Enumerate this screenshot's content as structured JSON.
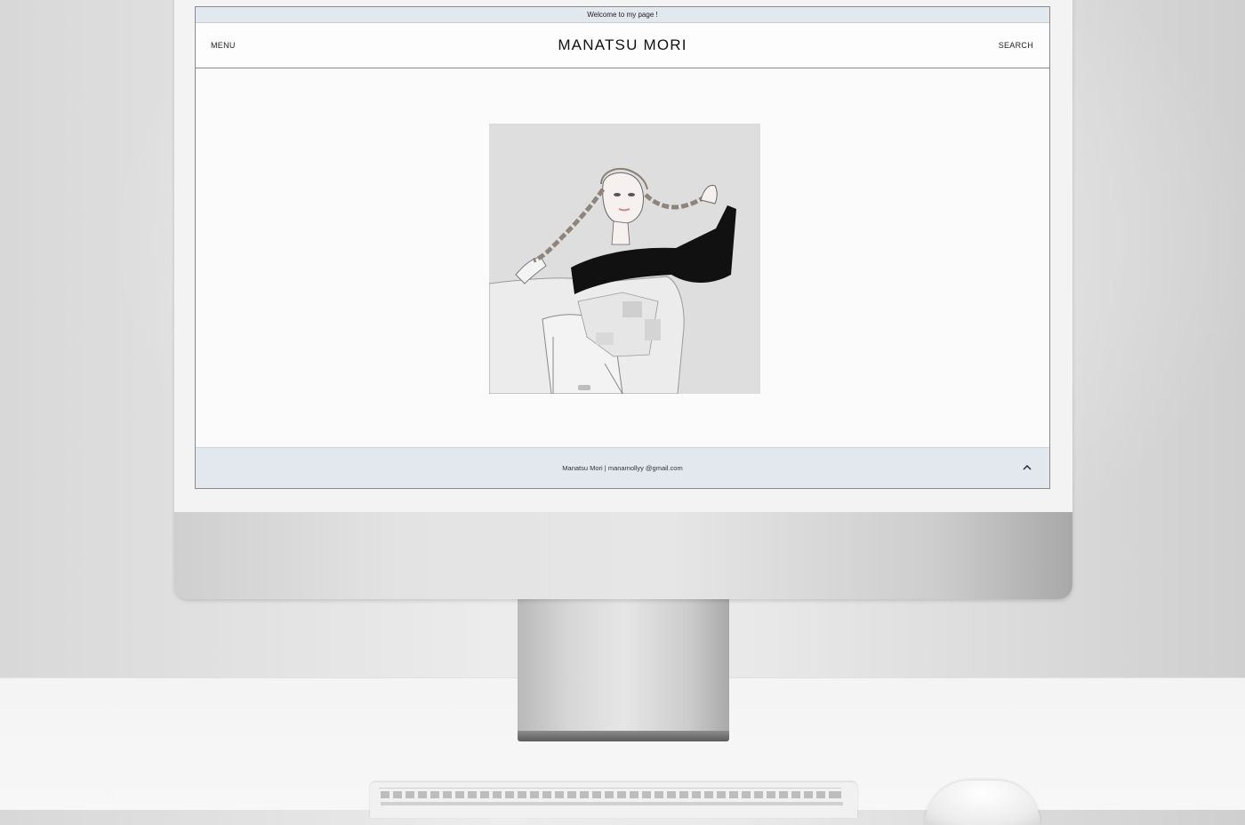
{
  "announcement": "Welcome to my page !",
  "header": {
    "menu_label": "MENU",
    "site_title": "MANATSU MORI",
    "search_label": "SEARCH"
  },
  "footer": {
    "credit": "Manatsu Mori | manamollyy @gmail.com"
  },
  "icons": {
    "back_to_top": "chevron-up-icon"
  },
  "colors": {
    "announcement_bar": "#e3e8ef",
    "footer_bar": "#e3e8ef",
    "page_background": "#fbfbfb",
    "artwork_background": "#dedede"
  }
}
